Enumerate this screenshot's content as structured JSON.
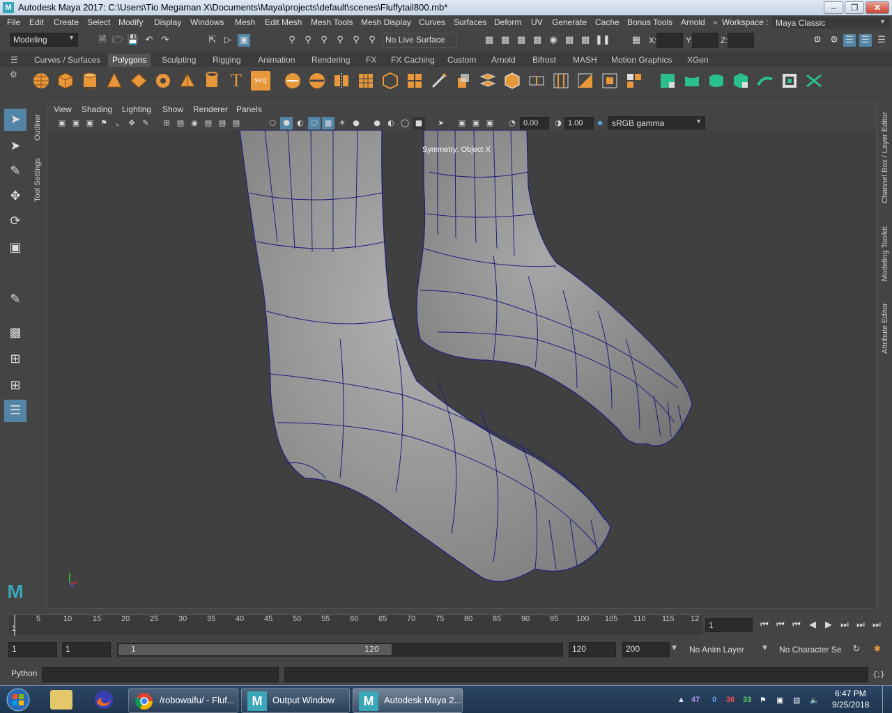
{
  "window": {
    "title": "Autodesk Maya 2017: C:\\Users\\Tio Megaman X\\Documents\\Maya\\projects\\default\\scenes\\Fluffytail800.mb*",
    "icon_letter": "M"
  },
  "menubar": {
    "items": [
      "File",
      "Edit",
      "Create",
      "Select",
      "Modify",
      "Display",
      "Windows",
      "Mesh",
      "Edit Mesh",
      "Mesh Tools",
      "Mesh Display",
      "Curves",
      "Surfaces",
      "Deform",
      "UV",
      "Generate",
      "Cache",
      "Bonus Tools",
      "Arnold"
    ],
    "workspace_label": "Workspace :",
    "workspace_value": "Maya Classic"
  },
  "statusline": {
    "mode": "Modeling",
    "live_surface": "No Live Surface",
    "x_label": "X:",
    "y_label": "Y:",
    "z_label": "Z:"
  },
  "shelf": {
    "tabs": [
      "Curves / Surfaces",
      "Polygons",
      "Sculpting",
      "Rigging",
      "Animation",
      "Rendering",
      "FX",
      "FX Caching",
      "Custom",
      "Arnold",
      "Bifrost",
      "MASH",
      "Motion Graphics",
      "XGen"
    ],
    "active_tab": "Polygons",
    "text_icon": "T",
    "svg_icon": "svg"
  },
  "side_tabs": {
    "outliner": "Outliner",
    "tool_settings": "Tool Settings",
    "channel_box": "Channel Box / Layer Editor",
    "modeling_toolkit": "Modeling Toolkit",
    "attribute_editor": "Attribute Editor"
  },
  "viewport": {
    "menus": [
      "View",
      "Shading",
      "Lighting",
      "Show",
      "Renderer",
      "Panels"
    ],
    "exposure": "0.00",
    "gamma": "1.00",
    "color_space": "sRGB gamma",
    "symmetry": "Symmetry: Object X"
  },
  "timeline": {
    "ticks": [
      "1",
      "5",
      "10",
      "15",
      "20",
      "25",
      "30",
      "35",
      "40",
      "45",
      "50",
      "55",
      "60",
      "65",
      "70",
      "75",
      "80",
      "85",
      "90",
      "95",
      "100",
      "105",
      "110",
      "115",
      "12"
    ],
    "current_frame": "1"
  },
  "range": {
    "start": "1",
    "anim_start": "1",
    "range_start": "1",
    "range_end": "120",
    "end": "120",
    "anim_end": "200",
    "anim_layer": "No Anim Layer",
    "char_set": "No Character Set"
  },
  "cmdline": {
    "language": "Python"
  },
  "taskbar": {
    "buttons": [
      "/robowaifu/ - Fluf...",
      "Output Window",
      "Autodesk Maya 2..."
    ],
    "tray_numbers": [
      "47",
      "0",
      "36",
      "33"
    ],
    "time": "6:47 PM",
    "date": "9/25/2018"
  },
  "colors": {
    "accent": "#5285a6",
    "shelf_orange": "#e8973a",
    "shelf_green": "#2bbf8c",
    "wireframe": "#1c1f7a",
    "mesh": "#9a9a9a"
  }
}
